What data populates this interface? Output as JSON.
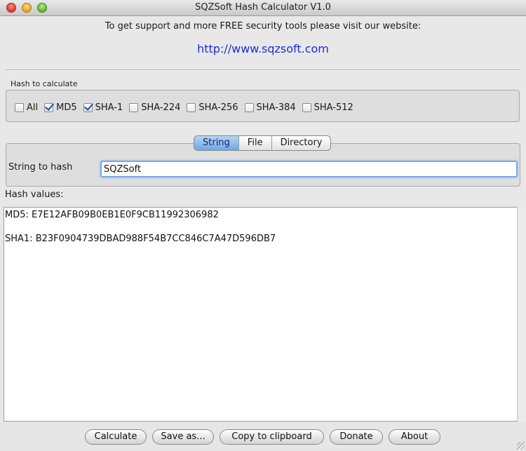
{
  "window": {
    "title": "SQZSoft Hash Calculator V1.0"
  },
  "header": {
    "support_text": "To get support and more FREE security tools please visit our website:",
    "website_link": "http://www.sqzsoft.com"
  },
  "hash_group": {
    "label": "Hash to calculate",
    "options": [
      {
        "label": "All",
        "checked": false
      },
      {
        "label": "MD5",
        "checked": true
      },
      {
        "label": "SHA-1",
        "checked": true
      },
      {
        "label": "SHA-224",
        "checked": false
      },
      {
        "label": "SHA-256",
        "checked": false
      },
      {
        "label": "SHA-384",
        "checked": false
      },
      {
        "label": "SHA-512",
        "checked": false
      }
    ]
  },
  "tabs": {
    "items": [
      "String",
      "File",
      "Directory"
    ],
    "active": "String"
  },
  "string_panel": {
    "label": "String to hash",
    "value": "SQZSoft"
  },
  "results": {
    "label": "Hash values:",
    "lines": [
      "MD5: E7E12AFB09B0EB1E0F9CB11992306982",
      "SHA1: B23F0904739DBAD988F54B7CC846C7A47D596DB7"
    ]
  },
  "buttons": {
    "calculate": "Calculate",
    "save_as": "Save as...",
    "copy": "Copy to clipboard",
    "donate": "Donate",
    "about": "About"
  },
  "colors": {
    "link": "#1a2fd6",
    "tab_active": "#6fa6e6",
    "checkmark": "#1e4fb0"
  }
}
